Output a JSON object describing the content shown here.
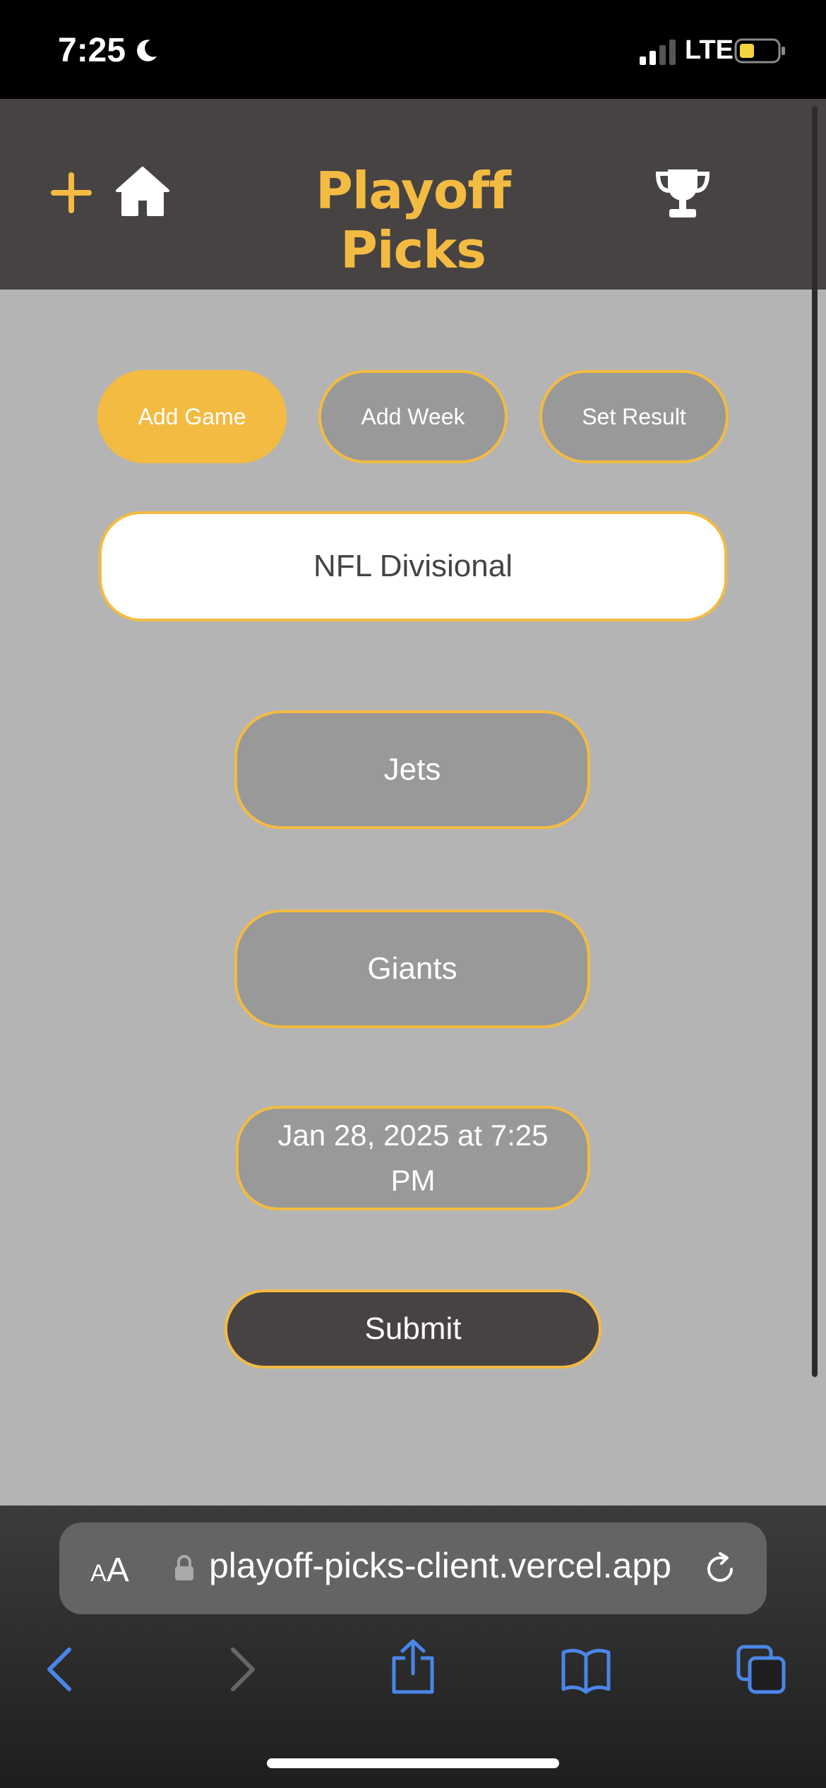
{
  "status_bar": {
    "time": "7:25",
    "network": "LTE"
  },
  "header": {
    "title": "Playoff Picks",
    "accent_color": "#f3bb42",
    "background_color": "#474343",
    "icons": [
      "plus-icon",
      "home-icon",
      "trophy-icon"
    ]
  },
  "actions": {
    "add_game": "Add Game",
    "add_week": "Add Week",
    "set_result": "Set Result",
    "active": "add_game"
  },
  "form": {
    "week_value": "NFL Divisional",
    "team1": "Jets",
    "team2": "Giants",
    "datetime": "Jan 28, 2025 at 7:25 PM",
    "submit_label": "Submit"
  },
  "browser": {
    "text_size_label_small": "A",
    "text_size_label_large": "A",
    "url": "playoff-picks-client.vercel.app"
  }
}
